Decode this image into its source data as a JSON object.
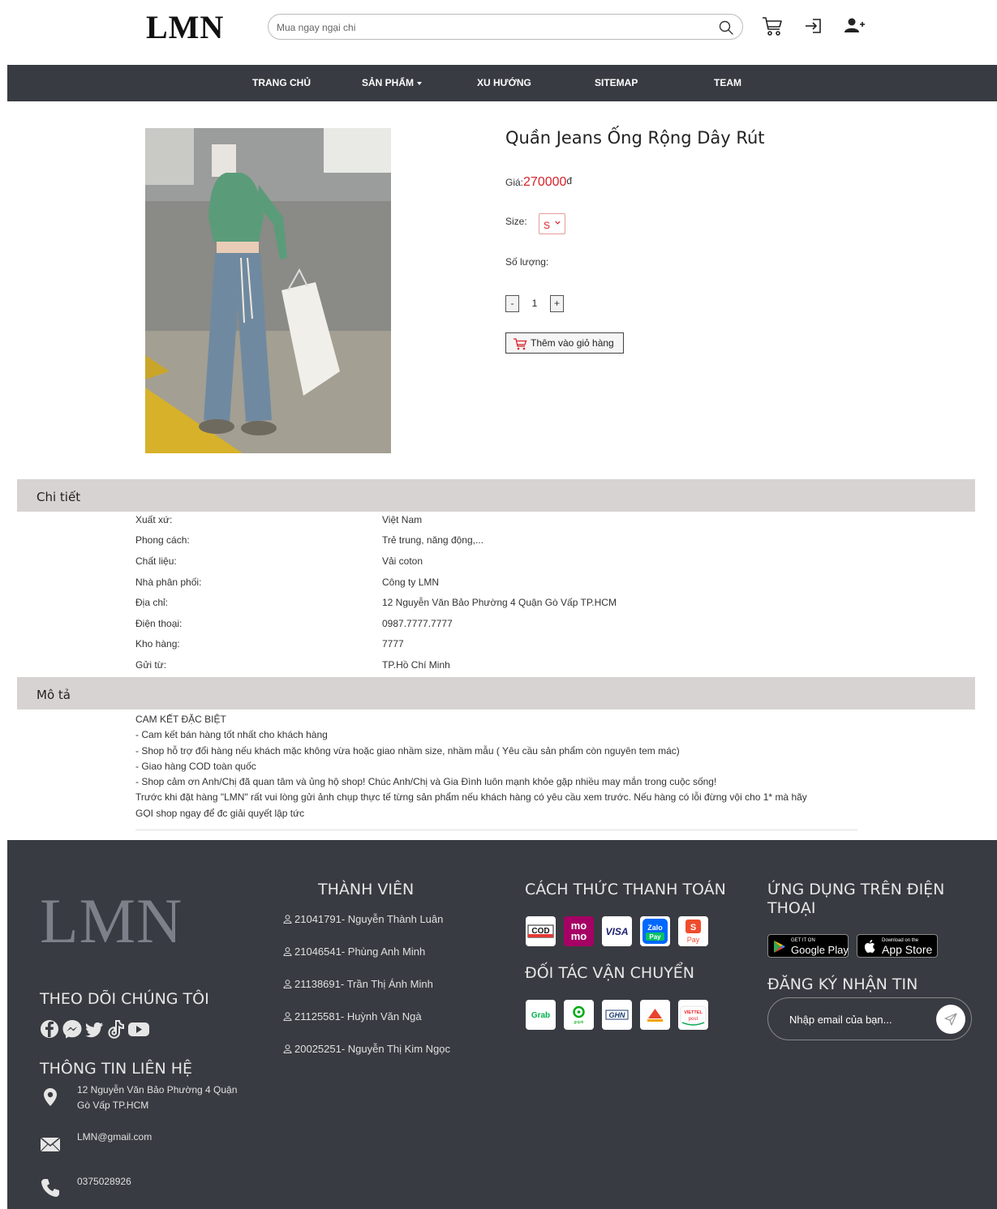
{
  "header": {
    "logo": "LMN",
    "search_placeholder": "Mua ngay ngại chi",
    "icons": [
      "search-icon",
      "cart-icon",
      "login-icon",
      "add-user-icon"
    ]
  },
  "nav": {
    "items": [
      {
        "label": "TRANG CHỦ"
      },
      {
        "label": "SẢN PHẨM",
        "has_caret": true
      },
      {
        "label": "XU HƯỚNG"
      },
      {
        "label": "SITEMAP"
      },
      {
        "label": "TEAM"
      }
    ]
  },
  "product": {
    "title": "Quần Jeans Ống Rộng Dây Rút",
    "price_label": "Giá:",
    "price_value": "270000",
    "price_currency": "đ",
    "size_label": "Size:",
    "size_value": "S",
    "quantity_label": "Số lượng:",
    "qty_minus": "-",
    "qty_value": "1",
    "qty_plus": "+",
    "add_to_cart": "Thêm vào giỏ hàng"
  },
  "details": {
    "heading": "Chi tiết",
    "rows": [
      {
        "label": "Xuất xứ:",
        "value": "Việt Nam"
      },
      {
        "label": "Phong cách:",
        "value": "Trẻ trung, năng động,..."
      },
      {
        "label": "Chất liệu:",
        "value": "Vải coton"
      },
      {
        "label": "Nhà phân phối:",
        "value": "Công ty LMN"
      },
      {
        "label": "Địa chỉ:",
        "value": "12 Nguyễn Văn Bảo Phường 4 Quận Gò Vấp TP.HCM"
      },
      {
        "label": "Điện thoại:",
        "value": "0987.7777.7777"
      },
      {
        "label": "Kho hàng:",
        "value": "7777"
      },
      {
        "label": "Gửi từ:",
        "value": "TP.Hồ Chí Minh"
      }
    ]
  },
  "description": {
    "heading": "Mô tả",
    "lines": [
      "CAM KẾT ĐẶC BIỆT",
      "- Cam kết bán hàng tốt nhất cho khách hàng",
      "- Shop hỗ trợ đổi hàng nếu khách mặc không vừa hoặc giao nhầm size, nhầm mẫu ( Yêu cầu sản phẩm còn nguyên tem mác)",
      "- Giao hàng COD toàn quốc",
      "- Shop cảm ơn Anh/Chị đã quan tâm và ủng hộ shop! Chúc Anh/Chị và Gia Đình luôn mạnh khỏe gặp nhiều may mắn trong cuộc sống!",
      "Trước khi đặt hàng \"LMN\" rất vui lòng gửi ảnh chụp thực tế từng sản phẩm nếu khách hàng có yêu cầu xem trước. Nếu hàng có lỗi đừng vội cho 1* mà hãy",
      "GỌI shop ngay để đc giải quyết lập tức"
    ]
  },
  "footer": {
    "logo": "LMN",
    "follow_heading": "THEO DÕI CHÚNG TÔI",
    "social_icons": [
      "facebook-icon",
      "messenger-icon",
      "twitter-icon",
      "tiktok-icon",
      "youtube-icon"
    ],
    "contact_heading": "THÔNG TIN LIÊN HỆ",
    "address_line1": "12 Nguyễn Văn Bảo Phường 4 Quận",
    "address_line2": "Gò Vấp TP.HCM",
    "email": "LMN@gmail.com",
    "phone": "0375028926",
    "members_heading": "THÀNH VIÊN",
    "members": [
      "21041791- Nguyễn Thành Luân",
      "21046541- Phùng Anh Minh",
      "21138691- Trần Thị Ánh Minh",
      "21125581- Huỳnh Văn Ngà",
      "20025251- Nguyễn Thị Kim Ngọc"
    ],
    "payment_heading": "CÁCH THỨC THANH TOÁN",
    "payment": {
      "cod": "COD",
      "momo_1": "mo",
      "momo_2": "mo",
      "visa": "VISA",
      "zalo_1": "Zalo",
      "zalo_2": "Pay",
      "shopee_1": "S",
      "shopee_2": "Pay"
    },
    "shipping_heading": "ĐỐI TÁC VẬN CHUYỂN",
    "shipping": {
      "grab": "Grab",
      "gojek": "gojek",
      "ghn": "GHN",
      "viettel_1": "VIETTEL",
      "viettel_2": "post"
    },
    "app_heading_1": "ỨNG DỤNG TRÊN ĐIỆN",
    "app_heading_2": "THOẠI",
    "google_small": "GET IT ON",
    "google_big": "Google Play",
    "apple_small": "Download on the",
    "apple_big": "App Store",
    "newsletter_heading": "ĐĂNG KÝ NHẬN TIN",
    "newsletter_placeholder": "Nhập email của bạn..."
  },
  "colors": {
    "nav_bg": "#383b41",
    "footer_bg": "#383b41",
    "section_bar": "#d8d3d3",
    "price": "#d8222a"
  }
}
